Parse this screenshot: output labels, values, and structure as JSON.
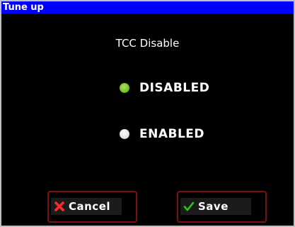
{
  "window": {
    "title": "Tune up"
  },
  "main": {
    "heading": "TCC Disable",
    "options": [
      {
        "label": "DISABLED",
        "selected": true
      },
      {
        "label": "ENABLED",
        "selected": false
      }
    ]
  },
  "buttons": {
    "cancel_label": "Cancel",
    "cancel_icon": "x-icon",
    "save_label": "Save",
    "save_icon": "checkmark-icon"
  },
  "colors": {
    "titlebar": "#0000ff",
    "background": "#000000",
    "selected_radio": "#7cc22a",
    "unselected_radio": "#e6e6e6",
    "button_border": "#7a1010",
    "cancel_icon": "#ff2a2a",
    "save_icon": "#2ec41e"
  }
}
